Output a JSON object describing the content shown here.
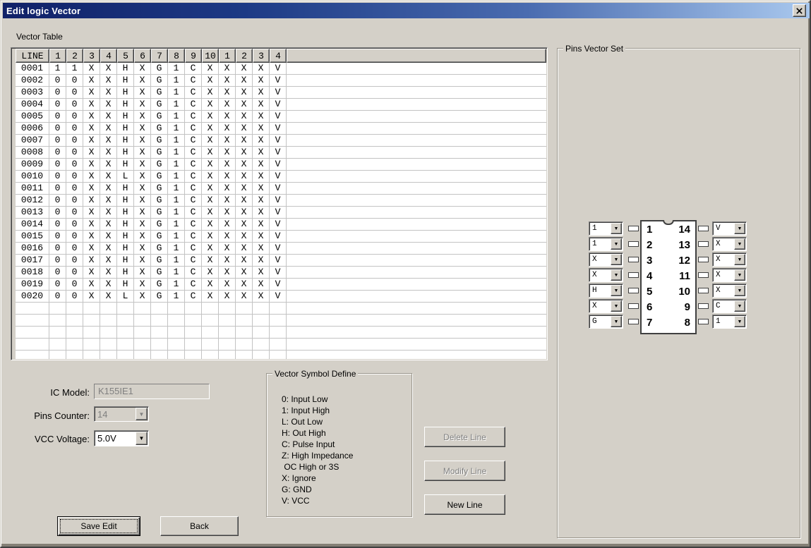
{
  "window": {
    "title": "Edit logic Vector"
  },
  "icons": {
    "close": "x-cross",
    "dropdown_arrow": "▼"
  },
  "colors": {
    "dialog_bg": "#d4d0c8",
    "title_gradient_start": "#102168",
    "title_gradient_end": "#a9c8ee",
    "disabled_text": "#808080",
    "grid_line": "#c3c3c3"
  },
  "vector_table": {
    "label": "Vector Table",
    "columns": [
      "LINE",
      "1",
      "2",
      "3",
      "4",
      "5",
      "6",
      "7",
      "8",
      "9",
      "10",
      "1",
      "2",
      "3",
      "4"
    ],
    "rows": [
      {
        "line": "0001",
        "values": [
          "1",
          "1",
          "X",
          "X",
          "H",
          "X",
          "G",
          "1",
          "C",
          "X",
          "X",
          "X",
          "X",
          "V"
        ]
      },
      {
        "line": "0002",
        "values": [
          "0",
          "0",
          "X",
          "X",
          "H",
          "X",
          "G",
          "1",
          "C",
          "X",
          "X",
          "X",
          "X",
          "V"
        ]
      },
      {
        "line": "0003",
        "values": [
          "0",
          "0",
          "X",
          "X",
          "H",
          "X",
          "G",
          "1",
          "C",
          "X",
          "X",
          "X",
          "X",
          "V"
        ]
      },
      {
        "line": "0004",
        "values": [
          "0",
          "0",
          "X",
          "X",
          "H",
          "X",
          "G",
          "1",
          "C",
          "X",
          "X",
          "X",
          "X",
          "V"
        ]
      },
      {
        "line": "0005",
        "values": [
          "0",
          "0",
          "X",
          "X",
          "H",
          "X",
          "G",
          "1",
          "C",
          "X",
          "X",
          "X",
          "X",
          "V"
        ]
      },
      {
        "line": "0006",
        "values": [
          "0",
          "0",
          "X",
          "X",
          "H",
          "X",
          "G",
          "1",
          "C",
          "X",
          "X",
          "X",
          "X",
          "V"
        ]
      },
      {
        "line": "0007",
        "values": [
          "0",
          "0",
          "X",
          "X",
          "H",
          "X",
          "G",
          "1",
          "C",
          "X",
          "X",
          "X",
          "X",
          "V"
        ]
      },
      {
        "line": "0008",
        "values": [
          "0",
          "0",
          "X",
          "X",
          "H",
          "X",
          "G",
          "1",
          "C",
          "X",
          "X",
          "X",
          "X",
          "V"
        ]
      },
      {
        "line": "0009",
        "values": [
          "0",
          "0",
          "X",
          "X",
          "H",
          "X",
          "G",
          "1",
          "C",
          "X",
          "X",
          "X",
          "X",
          "V"
        ]
      },
      {
        "line": "0010",
        "values": [
          "0",
          "0",
          "X",
          "X",
          "L",
          "X",
          "G",
          "1",
          "C",
          "X",
          "X",
          "X",
          "X",
          "V"
        ]
      },
      {
        "line": "0011",
        "values": [
          "0",
          "0",
          "X",
          "X",
          "H",
          "X",
          "G",
          "1",
          "C",
          "X",
          "X",
          "X",
          "X",
          "V"
        ]
      },
      {
        "line": "0012",
        "values": [
          "0",
          "0",
          "X",
          "X",
          "H",
          "X",
          "G",
          "1",
          "C",
          "X",
          "X",
          "X",
          "X",
          "V"
        ]
      },
      {
        "line": "0013",
        "values": [
          "0",
          "0",
          "X",
          "X",
          "H",
          "X",
          "G",
          "1",
          "C",
          "X",
          "X",
          "X",
          "X",
          "V"
        ]
      },
      {
        "line": "0014",
        "values": [
          "0",
          "0",
          "X",
          "X",
          "H",
          "X",
          "G",
          "1",
          "C",
          "X",
          "X",
          "X",
          "X",
          "V"
        ]
      },
      {
        "line": "0015",
        "values": [
          "0",
          "0",
          "X",
          "X",
          "H",
          "X",
          "G",
          "1",
          "C",
          "X",
          "X",
          "X",
          "X",
          "V"
        ]
      },
      {
        "line": "0016",
        "values": [
          "0",
          "0",
          "X",
          "X",
          "H",
          "X",
          "G",
          "1",
          "C",
          "X",
          "X",
          "X",
          "X",
          "V"
        ]
      },
      {
        "line": "0017",
        "values": [
          "0",
          "0",
          "X",
          "X",
          "H",
          "X",
          "G",
          "1",
          "C",
          "X",
          "X",
          "X",
          "X",
          "V"
        ]
      },
      {
        "line": "0018",
        "values": [
          "0",
          "0",
          "X",
          "X",
          "H",
          "X",
          "G",
          "1",
          "C",
          "X",
          "X",
          "X",
          "X",
          "V"
        ]
      },
      {
        "line": "0019",
        "values": [
          "0",
          "0",
          "X",
          "X",
          "H",
          "X",
          "G",
          "1",
          "C",
          "X",
          "X",
          "X",
          "X",
          "V"
        ]
      },
      {
        "line": "0020",
        "values": [
          "0",
          "0",
          "X",
          "X",
          "L",
          "X",
          "G",
          "1",
          "C",
          "X",
          "X",
          "X",
          "X",
          "V"
        ]
      }
    ],
    "empty_rows": 5
  },
  "pins_vector_set": {
    "label": "Pins Vector Set",
    "left_pins": [
      {
        "pin": "1",
        "value": "1"
      },
      {
        "pin": "2",
        "value": "1"
      },
      {
        "pin": "3",
        "value": "X"
      },
      {
        "pin": "4",
        "value": "X"
      },
      {
        "pin": "5",
        "value": "H"
      },
      {
        "pin": "6",
        "value": "X"
      },
      {
        "pin": "7",
        "value": "G"
      }
    ],
    "right_pins": [
      {
        "pin": "14",
        "value": "V"
      },
      {
        "pin": "13",
        "value": "X"
      },
      {
        "pin": "12",
        "value": "X"
      },
      {
        "pin": "11",
        "value": "X"
      },
      {
        "pin": "10",
        "value": "X"
      },
      {
        "pin": "9",
        "value": "C"
      },
      {
        "pin": "8",
        "value": "1"
      }
    ]
  },
  "form": {
    "ic_model_label": "IC Model:",
    "ic_model_value": "K155IE1",
    "pins_counter_label": "Pins Counter:",
    "pins_counter_value": "14",
    "vcc_label": "VCC Voltage:",
    "vcc_value": "5.0V"
  },
  "symbol_define": {
    "label": "Vector Symbol Define",
    "lines": [
      "0: Input Low",
      "1: Input High",
      "L: Out Low",
      "H: Out High",
      "C: Pulse Input",
      "Z: High Impedance",
      " OC High or 3S",
      "X: Ignore",
      "G: GND",
      "V: VCC"
    ]
  },
  "buttons": {
    "delete_line": "Delete Line",
    "modify_line": "Modify Line",
    "new_line": "New Line",
    "save_edit": "Save Edit",
    "back": "Back"
  }
}
